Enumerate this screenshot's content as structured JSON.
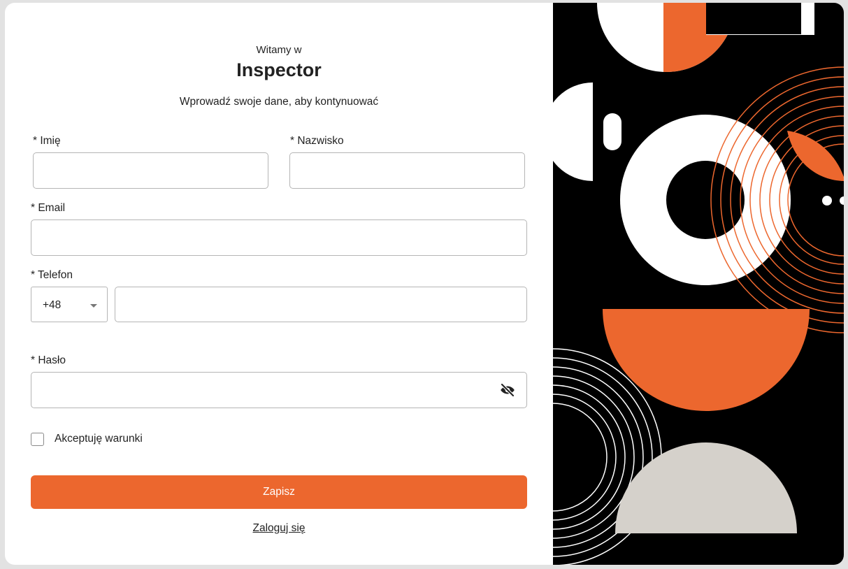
{
  "header": {
    "welcome": "Witamy w",
    "app_name": "Inspector",
    "subtitle": "Wprowadź swoje dane, aby kontynuować"
  },
  "form": {
    "first_name": {
      "label": "* Imię",
      "value": ""
    },
    "last_name": {
      "label": "* Nazwisko",
      "value": ""
    },
    "email": {
      "label": "* Email",
      "value": ""
    },
    "phone": {
      "label": "* Telefon",
      "country_code": "+48",
      "value": ""
    },
    "password": {
      "label": "* Hasło",
      "value": ""
    },
    "terms": {
      "label": "Akceptuję warunki",
      "checked": false
    },
    "submit_label": "Zapisz",
    "login_link": "Zaloguj się"
  },
  "icons": {
    "caret": "chevron-down-icon",
    "password_toggle": "eye-slash-icon"
  },
  "colors": {
    "accent": "#ec672e",
    "art_background": "#000000",
    "art_beige": "#d5d1cb",
    "page_background": "#e2e2e2"
  }
}
